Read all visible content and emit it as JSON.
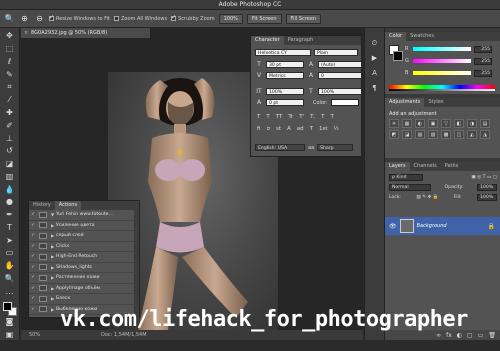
{
  "app": {
    "title": "Adobe Photoshop CC"
  },
  "options_bar": {
    "resize_windows": "Resize Windows to Fit",
    "zoom_all": "Zoom All Windows",
    "scrubby_zoom": "Scrubby Zoom",
    "btn_100": "100%",
    "btn_fit": "Fit Screen",
    "btn_fill": "Fill Screen"
  },
  "document": {
    "tab_title": "8G0A2932.jpg @ 50% (RGB/8)",
    "zoom": "50%",
    "doc_info": "Doc: 1,54M/1,54M"
  },
  "character_panel": {
    "tabs": [
      "Character",
      "Paragraph"
    ],
    "font_family": "Helvetica CY",
    "font_style": "Plain",
    "font_size": "30 pt",
    "leading": "(Auto)",
    "kerning": "Metrics",
    "tracking": "0",
    "vscale": "100%",
    "hscale": "100%",
    "baseline": "0 pt",
    "color_label": "Color:",
    "type_styles": [
      "T",
      "T",
      "TT",
      "Tr",
      "T'",
      "T,",
      "T",
      "T"
    ],
    "opentype": [
      "fi",
      "σ",
      "st",
      "A",
      "ad",
      "T",
      "1st",
      "½"
    ],
    "language": "English: USA",
    "aa_icon": "aa",
    "antialias": "Sharp"
  },
  "actions_panel": {
    "tabs": [
      "History",
      "Actions"
    ],
    "items": [
      "Yuri Fehin www.fotoute...",
      "Усиление цвета",
      "серый слой",
      "Clicks",
      "High-End Retouch",
      "SHadows_lights",
      "Растяжение кожи",
      "ApplyImage объём",
      "Блеск",
      "Выбеление кожи"
    ]
  },
  "color_panel": {
    "tabs": [
      "Color",
      "Swatches"
    ],
    "r_label": "R",
    "g_label": "G",
    "b_label": "B",
    "r": "255",
    "g": "255",
    "b": "255"
  },
  "adjustments_panel": {
    "tabs": [
      "Adjustments",
      "Styles"
    ],
    "title": "Add an adjustment",
    "icons": [
      "☀",
      "▦",
      "◐",
      "▣",
      "▽",
      "◧",
      "◑",
      "▤",
      "◩",
      "◪",
      "▧",
      "▨",
      "▩",
      "◫",
      "◭",
      "◮"
    ]
  },
  "layers_panel": {
    "tabs": [
      "Layers",
      "Channels",
      "Paths"
    ],
    "kind": "ρ Kind",
    "blend_mode": "Normal",
    "opacity_label": "Opacity:",
    "opacity": "100%",
    "lock_label": "Lock:",
    "fill_label": "Fill:",
    "fill": "100%",
    "layer_name": "Background",
    "bottom_icons": [
      "∞",
      "fx",
      "◐",
      "▢",
      "▭",
      "🗑"
    ]
  },
  "watermark": "vk.com/lifehack_for_photographer"
}
